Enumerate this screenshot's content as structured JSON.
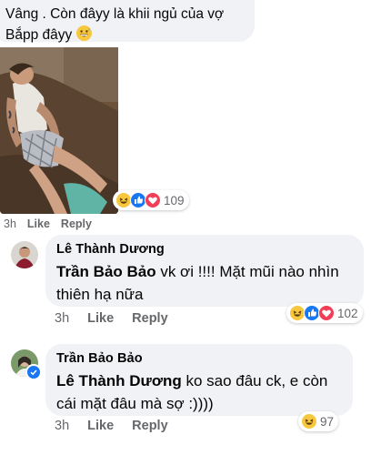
{
  "comments": [
    {
      "text": "Vâng . Còn đâyy là khii ngủ của vợ Bắpp đâyy",
      "emoji": "grinning-sweat-emoji",
      "time": "3h",
      "like": "Like",
      "reply": "Reply",
      "reaction_count": "109",
      "reactions": [
        "haha",
        "like",
        "love"
      ]
    },
    {
      "author": "Lê Thành Dương",
      "mention": "Trần Bảo Bảo",
      "text": "vk ơi !!!! Mặt mũi nào nhìn thiên hạ nữa",
      "time": "3h",
      "like": "Like",
      "reply": "Reply",
      "reaction_count": "102",
      "reactions": [
        "haha",
        "like",
        "love"
      ]
    },
    {
      "author": "Trần Bảo Bảo",
      "mention": "Lê Thành Dương",
      "text": "ko sao đâu ck, e còn cái mặt đâu mà sợ :))))",
      "time": "3h",
      "like": "Like",
      "reply": "Reply",
      "reaction_count": "97",
      "reactions": [
        "haha"
      ]
    }
  ],
  "colors": {
    "bubble": "#f0f2f5",
    "meta": "#65676b",
    "like_blue": "#1877f2",
    "love_red": "#f33e58",
    "haha_yellow": "#f7c73e"
  }
}
